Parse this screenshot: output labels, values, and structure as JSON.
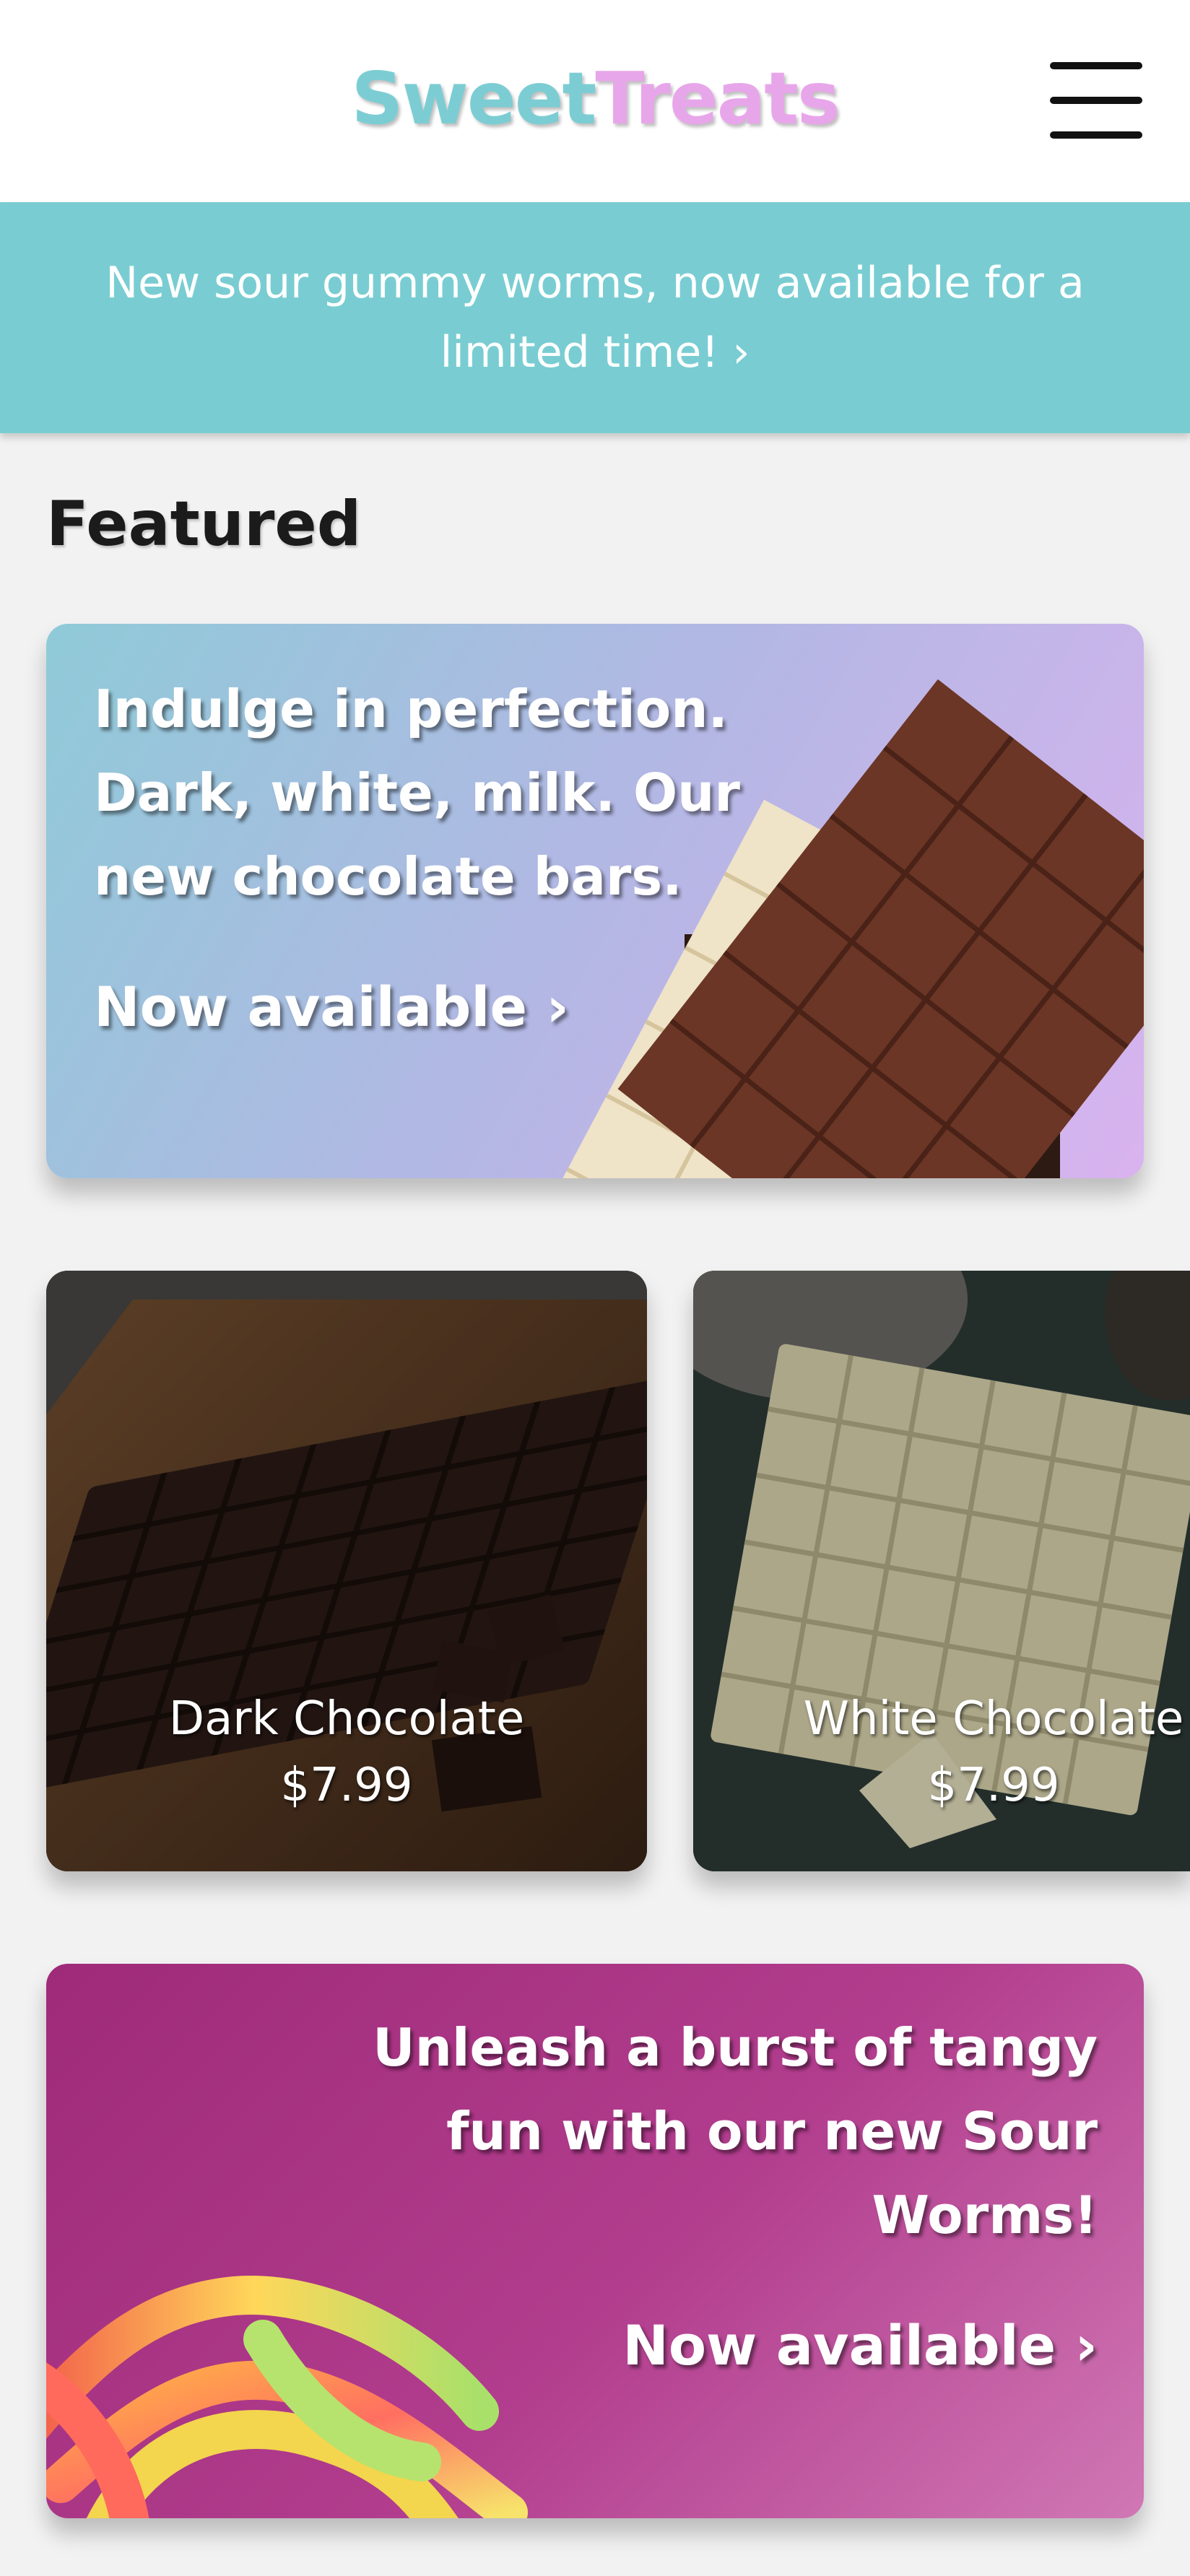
{
  "header": {
    "logo_part1": "Sweet",
    "logo_part2": "Treats",
    "menu_icon": "hamburger-menu-icon"
  },
  "announcement": {
    "text": "New sour gummy worms, now available for a limited time! ›"
  },
  "featured": {
    "title": "Featured",
    "promo_chocolate": {
      "line1": "Indulge in perfection.",
      "line2": "Dark, white, milk. Our",
      "line3": "new chocolate bars.",
      "cta": "Now available ›"
    },
    "products": [
      {
        "name": "Dark Chocolate",
        "price": "$7.99"
      },
      {
        "name": "White Chocolate",
        "price": "$7.99"
      }
    ],
    "promo_sour": {
      "line1": "Unleash a burst of tangy",
      "line2": "fun with our new Sour",
      "line3": "Worms!",
      "cta": "Now available ›"
    }
  },
  "colors": {
    "logo_teal": "#7ccdd3",
    "logo_pink": "#e8a6ea",
    "banner": "#79cdd2",
    "sour_promo": "#b23d8e"
  }
}
